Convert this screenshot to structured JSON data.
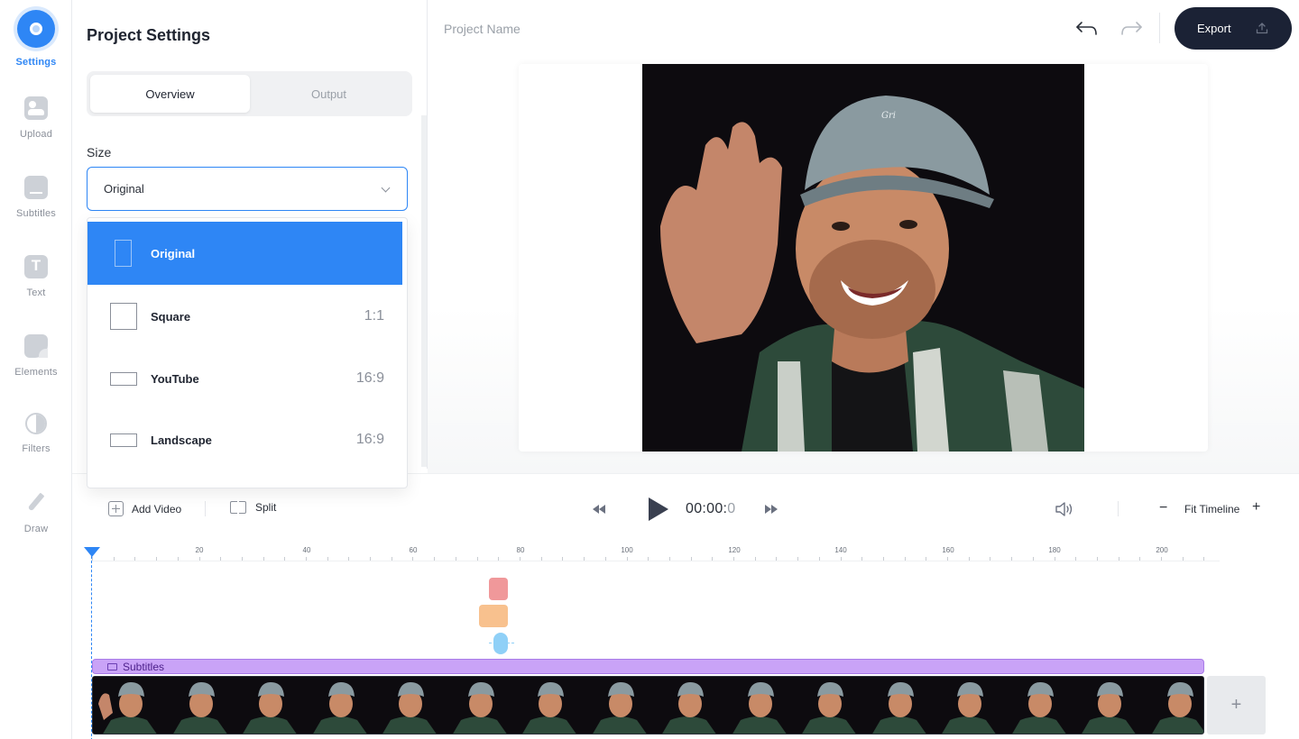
{
  "rail": {
    "items": [
      {
        "label": "Settings",
        "icon": "settings-icon"
      },
      {
        "label": "Upload",
        "icon": "upload-icon"
      },
      {
        "label": "Subtitles",
        "icon": "subtitles-icon"
      },
      {
        "label": "Text",
        "icon": "text-icon"
      },
      {
        "label": "Elements",
        "icon": "elements-icon"
      },
      {
        "label": "Filters",
        "icon": "filters-icon"
      },
      {
        "label": "Draw",
        "icon": "draw-icon"
      }
    ],
    "active": "Settings"
  },
  "panel": {
    "title": "Project Settings",
    "tabs": [
      {
        "label": "Overview",
        "active": true
      },
      {
        "label": "Output",
        "active": false
      }
    ],
    "size_label": "Size",
    "size_select": {
      "value": "Original"
    },
    "size_options": [
      {
        "name": "Original",
        "ratio": "",
        "selected": true
      },
      {
        "name": "Square",
        "ratio": "1:1",
        "selected": false
      },
      {
        "name": "YouTube",
        "ratio": "16:9",
        "selected": false
      },
      {
        "name": "Landscape",
        "ratio": "16:9",
        "selected": false
      }
    ]
  },
  "header": {
    "project_name": "Project Name",
    "export_label": "Export"
  },
  "player": {
    "add_video_label": "Add Video",
    "split_label": "Split",
    "timecode_main": "00:00:",
    "timecode_frac": "0",
    "fit_label": "Fit Timeline",
    "zoom_minus": "−",
    "zoom_plus": "+"
  },
  "timeline": {
    "ruler_labels": [
      "20",
      "40",
      "60",
      "80",
      "100",
      "120",
      "140",
      "160",
      "180",
      "200"
    ],
    "subtitle_track_label": "Subtitles",
    "add_track_label": "+"
  },
  "colors": {
    "accent": "#2e86f5",
    "export_bg": "#1b2235",
    "subtitle_track": "#c9a3f7",
    "clip_red": "#f0989a",
    "clip_orange": "#f8c18e",
    "clip_blue": "#8fd0f7"
  }
}
